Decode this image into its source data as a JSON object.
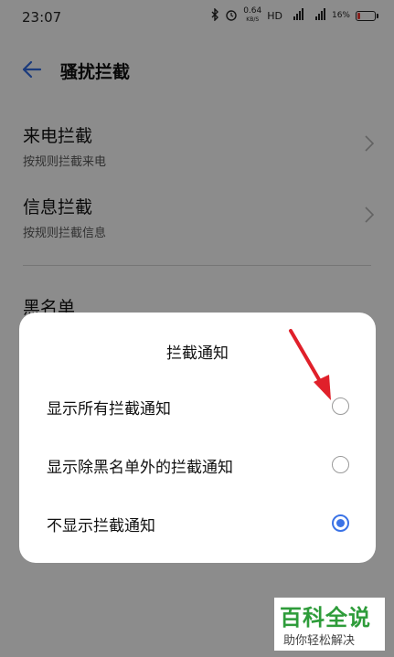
{
  "status_bar": {
    "time": "23:07",
    "speed_value": "0.64",
    "speed_unit": "KB/S",
    "hd": "HD",
    "signal1": "⁴ᴳ",
    "signal2": "⁴ᴳ",
    "battery": "16%"
  },
  "header": {
    "title": "骚扰拦截"
  },
  "list": {
    "items": [
      {
        "title": "来电拦截",
        "subtitle": "按规则拦截来电"
      },
      {
        "title": "信息拦截",
        "subtitle": "按规则拦截信息"
      }
    ],
    "blacklist": "黑名单"
  },
  "dialog": {
    "title": "拦截通知",
    "options": [
      {
        "label": "显示所有拦截通知",
        "selected": false
      },
      {
        "label": "显示除黑名单外的拦截通知",
        "selected": false
      },
      {
        "label": "不显示拦截通知",
        "selected": true
      }
    ]
  },
  "watermark": {
    "main": "百科全说",
    "sub": "助你轻松解决"
  },
  "colors": {
    "accent": "#3b73e6",
    "arrow": "#e0202a",
    "watermark": "#2e9c3a"
  }
}
